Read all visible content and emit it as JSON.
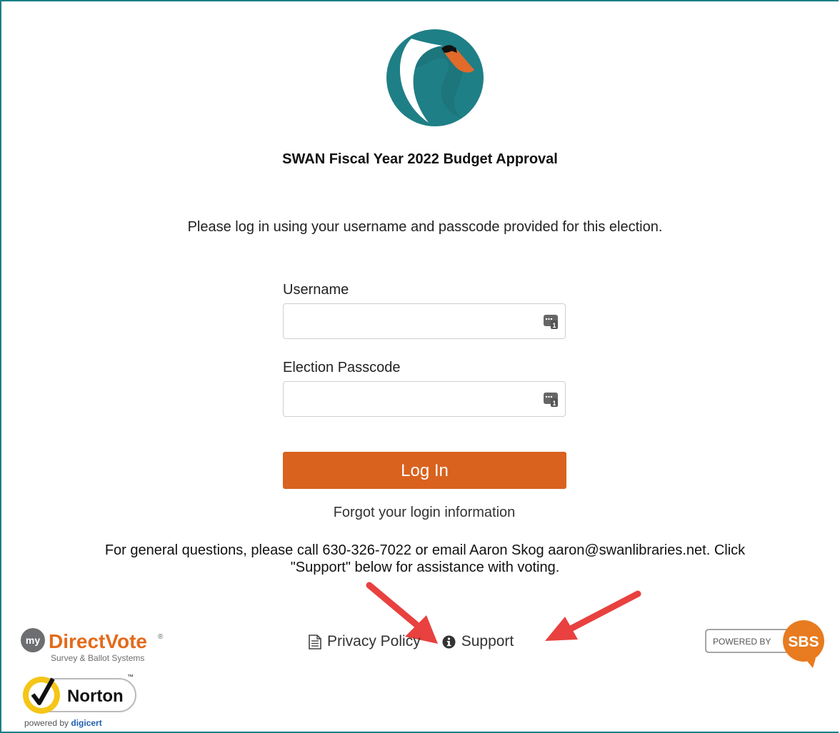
{
  "header": {
    "title": "SWAN Fiscal Year 2022 Budget Approval",
    "intro": "Please log in using your username and passcode provided for this election."
  },
  "form": {
    "username_label": "Username",
    "username_value": "",
    "passcode_label": "Election Passcode",
    "passcode_value": "",
    "login_label": "Log In",
    "forgot_label": "Forgot your login information"
  },
  "info": {
    "general_line1": "For general questions, please call 630-326-7022 or email Aaron Skog aaron@swanlibraries.net. Click",
    "general_line2": "\"Support\" below for assistance with voting."
  },
  "footer": {
    "privacy_label": "Privacy Policy",
    "support_label": "Support",
    "mdv_my": "my",
    "mdv_brand": "DirectVote",
    "mdv_reg": "®",
    "mdv_tag": "Survey & Ballot Systems",
    "norton_name": "Norton",
    "norton_tm": "™",
    "norton_powered": "powered by ",
    "norton_digicert": "digicert",
    "sbs_powered": "POWERED BY",
    "sbs_name": "SBS"
  },
  "colors": {
    "frame": "#1b7f86",
    "swan_teal": "#1f7f86",
    "login_button": "#d9621f",
    "arrow": "#e8413f",
    "mdv_orange": "#e36b1c",
    "norton_yellow": "#f5c518",
    "sbs_orange": "#e87b1f"
  },
  "icons": {
    "field_key": "password-manager-icon",
    "privacy": "document-icon",
    "support": "info-icon"
  }
}
